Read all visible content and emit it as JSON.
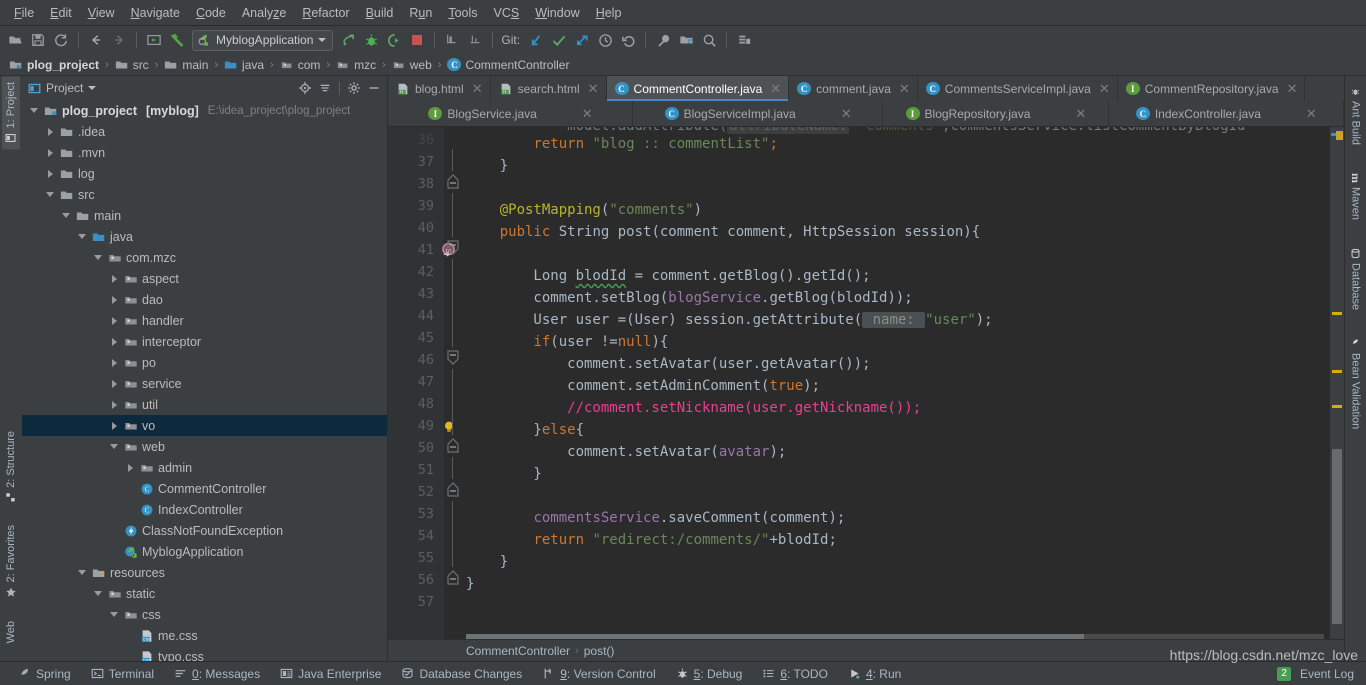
{
  "menubar": {
    "items": [
      {
        "label": "File",
        "mnemonic": "F"
      },
      {
        "label": "Edit",
        "mnemonic": "E"
      },
      {
        "label": "View",
        "mnemonic": "V"
      },
      {
        "label": "Navigate",
        "mnemonic": "N"
      },
      {
        "label": "Code",
        "mnemonic": "C"
      },
      {
        "label": "Analyze",
        "mnemonic": "z"
      },
      {
        "label": "Refactor",
        "mnemonic": "R"
      },
      {
        "label": "Build",
        "mnemonic": "B"
      },
      {
        "label": "Run",
        "mnemonic": "u"
      },
      {
        "label": "Tools",
        "mnemonic": "T"
      },
      {
        "label": "VCS",
        "mnemonic": "S"
      },
      {
        "label": "Window",
        "mnemonic": "W"
      },
      {
        "label": "Help",
        "mnemonic": "H"
      }
    ]
  },
  "toolbar": {
    "run_config": "MyblogApplication",
    "git_label": "Git:",
    "icons": [
      "open-folder-icon",
      "save-icon",
      "sync-icon",
      "back-arrow-icon",
      "forward-arrow-icon",
      "run-anything-icon",
      "build-hammer-icon"
    ],
    "right_icons": [
      "run-icon",
      "debug-icon",
      "run-coverage-icon",
      "stop-icon",
      "profile-icon",
      "attach-icon",
      "update-project-icon",
      "commit-icon",
      "push-icon",
      "history-icon",
      "rollback-icon",
      "settings-wrench-icon",
      "project-structure-icon",
      "search-everywhere-icon",
      "stack-icon"
    ]
  },
  "breadcrumb": {
    "items": [
      {
        "label": "plog_project",
        "icon": "module-icon",
        "bold": true
      },
      {
        "label": "src",
        "icon": "folder-icon",
        "bold": false
      },
      {
        "label": "main",
        "icon": "folder-icon",
        "bold": false
      },
      {
        "label": "java",
        "icon": "source-folder-icon",
        "bold": false
      },
      {
        "label": "com",
        "icon": "package-icon",
        "bold": false
      },
      {
        "label": "mzc",
        "icon": "package-icon",
        "bold": false
      },
      {
        "label": "web",
        "icon": "package-icon",
        "bold": false
      },
      {
        "label": "CommentController",
        "icon": "java-class-icon",
        "bold": false
      }
    ],
    "separator": "›"
  },
  "left_tool_tabs": [
    {
      "label": "1: Project",
      "icon": "project-icon",
      "active": true
    },
    {
      "label": "2: Structure",
      "icon": "structure-icon",
      "active": false
    },
    {
      "label": "2: Favorites",
      "icon": "star-icon",
      "active": false
    },
    {
      "label": "Web",
      "icon": "web-icon",
      "active": false
    }
  ],
  "right_tool_tabs": [
    {
      "label": "Ant Build",
      "icon": "ant-icon"
    },
    {
      "label": "Maven",
      "icon": "maven-icon"
    },
    {
      "label": "Database",
      "icon": "database-icon"
    },
    {
      "label": "Bean Validation",
      "icon": "bean-icon"
    }
  ],
  "project_panel": {
    "title": "Project",
    "actions": [
      "locate-icon",
      "collapse-all-icon",
      "settings-gear-icon",
      "hide-icon"
    ],
    "tree": [
      {
        "indent": 0,
        "twisty": "down",
        "icon": "module-icon",
        "label": "plog_project",
        "bold": true,
        "suffix": "[myblog]",
        "path": "E:\\idea_project\\plog_project",
        "selected": false
      },
      {
        "indent": 1,
        "twisty": "right",
        "icon": "folder-icon",
        "label": ".idea",
        "selected": false
      },
      {
        "indent": 1,
        "twisty": "right",
        "icon": "folder-icon",
        "label": ".mvn",
        "selected": false
      },
      {
        "indent": 1,
        "twisty": "right",
        "icon": "folder-icon",
        "label": "log",
        "selected": false
      },
      {
        "indent": 1,
        "twisty": "down",
        "icon": "folder-icon",
        "label": "src",
        "selected": false
      },
      {
        "indent": 2,
        "twisty": "down",
        "icon": "folder-icon",
        "label": "main",
        "selected": false
      },
      {
        "indent": 3,
        "twisty": "down",
        "icon": "source-folder-icon",
        "label": "java",
        "selected": false
      },
      {
        "indent": 4,
        "twisty": "down",
        "icon": "package-icon",
        "label": "com.mzc",
        "selected": false
      },
      {
        "indent": 5,
        "twisty": "right",
        "icon": "package-icon",
        "label": "aspect",
        "selected": false
      },
      {
        "indent": 5,
        "twisty": "right",
        "icon": "package-icon",
        "label": "dao",
        "selected": false
      },
      {
        "indent": 5,
        "twisty": "right",
        "icon": "package-icon",
        "label": "handler",
        "selected": false
      },
      {
        "indent": 5,
        "twisty": "right",
        "icon": "package-icon",
        "label": "interceptor",
        "selected": false
      },
      {
        "indent": 5,
        "twisty": "right",
        "icon": "package-icon",
        "label": "po",
        "selected": false
      },
      {
        "indent": 5,
        "twisty": "right",
        "icon": "package-icon",
        "label": "service",
        "selected": false
      },
      {
        "indent": 5,
        "twisty": "right",
        "icon": "package-icon",
        "label": "util",
        "selected": false
      },
      {
        "indent": 5,
        "twisty": "right",
        "icon": "package-icon",
        "label": "vo",
        "selected": true
      },
      {
        "indent": 5,
        "twisty": "down",
        "icon": "package-icon",
        "label": "web",
        "selected": false
      },
      {
        "indent": 6,
        "twisty": "right",
        "icon": "package-icon",
        "label": "admin",
        "selected": false
      },
      {
        "indent": 6,
        "twisty": "none",
        "icon": "java-class-icon",
        "label": "CommentController",
        "selected": false
      },
      {
        "indent": 6,
        "twisty": "none",
        "icon": "java-class-icon",
        "label": "IndexController",
        "selected": false
      },
      {
        "indent": 5,
        "twisty": "none",
        "icon": "java-exception-icon",
        "label": "ClassNotFoundException",
        "selected": false
      },
      {
        "indent": 5,
        "twisty": "none",
        "icon": "spring-boot-app-icon",
        "label": "MyblogApplication",
        "selected": false
      },
      {
        "indent": 3,
        "twisty": "down",
        "icon": "resources-folder-icon",
        "label": "resources",
        "selected": false
      },
      {
        "indent": 4,
        "twisty": "down",
        "icon": "package-icon",
        "label": "static",
        "selected": false
      },
      {
        "indent": 5,
        "twisty": "down",
        "icon": "package-icon",
        "label": "css",
        "selected": false
      },
      {
        "indent": 6,
        "twisty": "none",
        "icon": "css-file-icon",
        "label": "me.css",
        "selected": false
      },
      {
        "indent": 6,
        "twisty": "none",
        "icon": "css-file-icon",
        "label": "typo.css",
        "selected": false
      }
    ]
  },
  "editor": {
    "tabs_row1": [
      {
        "label": "blog.html",
        "icon": "html-file-icon",
        "active": false,
        "closable": true
      },
      {
        "label": "search.html",
        "icon": "html-file-icon",
        "active": false,
        "closable": true
      },
      {
        "label": "CommentController.java",
        "icon": "java-class-icon",
        "active": true,
        "closable": true
      },
      {
        "label": "comment.java",
        "icon": "java-class-icon",
        "active": false,
        "closable": true
      },
      {
        "label": "CommentsServiceImpl.java",
        "icon": "java-class-icon",
        "active": false,
        "closable": true
      },
      {
        "label": "CommentRepository.java",
        "icon": "java-interface-icon",
        "active": false,
        "closable": true
      }
    ],
    "tabs_row2": [
      {
        "label": "BlogService.java",
        "icon": "java-interface-icon",
        "active": false,
        "closable": true
      },
      {
        "label": "BlogServiceImpl.java",
        "icon": "java-class-icon",
        "active": false,
        "closable": true
      },
      {
        "label": "BlogRepository.java",
        "icon": "java-interface-icon",
        "active": false,
        "closable": true
      },
      {
        "label": "IndexController.java",
        "icon": "java-class-icon",
        "active": false,
        "closable": true
      }
    ],
    "first_line_number": 36,
    "lines": [
      {
        "n": 36,
        "clipped": true,
        "fold": "none",
        "tokens": [
          {
            "t": "            model.addAttribute(",
            "c": "punct"
          },
          {
            "t": "attributeName:",
            "c": "hint"
          },
          {
            "t": " ",
            "c": "punct"
          },
          {
            "t": "\"comments\"",
            "c": "str"
          },
          {
            "t": ",commentsService.listCommentByBlogId",
            "c": "punct"
          }
        ]
      },
      {
        "n": 37,
        "fold": "none",
        "tokens": [
          {
            "t": "        ",
            "c": "punct"
          },
          {
            "t": "return",
            "c": "kw"
          },
          {
            "t": " ",
            "c": "punct"
          },
          {
            "t": "\"blog :: commentList\"",
            "c": "str"
          },
          {
            "t": ";",
            "c": "semi"
          }
        ]
      },
      {
        "n": 38,
        "fold": "end",
        "tokens": [
          {
            "t": "    }",
            "c": "punct"
          }
        ]
      },
      {
        "n": 39,
        "fold": "none",
        "tokens": [
          {
            "t": "",
            "c": "punct"
          }
        ]
      },
      {
        "n": 40,
        "fold": "none",
        "tokens": [
          {
            "t": "    ",
            "c": "punct"
          },
          {
            "t": "@PostMapping",
            "c": "ann"
          },
          {
            "t": "(",
            "c": "punct"
          },
          {
            "t": "\"comments\"",
            "c": "str"
          },
          {
            "t": ")",
            "c": "punct"
          }
        ]
      },
      {
        "n": 41,
        "fold": "start",
        "marker": "override-icon",
        "tokens": [
          {
            "t": "    ",
            "c": "punct"
          },
          {
            "t": "public",
            "c": "kw"
          },
          {
            "t": " String post(comment comment, HttpSession session){",
            "c": "punct"
          }
        ]
      },
      {
        "n": 42,
        "fold": "none",
        "tokens": [
          {
            "t": "",
            "c": "punct"
          }
        ]
      },
      {
        "n": 43,
        "fold": "none",
        "tokens": [
          {
            "t": "        Long ",
            "c": "punct"
          },
          {
            "t": "blodId",
            "c": "squiggle"
          },
          {
            "t": " = comment.getBlog().getId();",
            "c": "punct"
          }
        ]
      },
      {
        "n": 44,
        "fold": "none",
        "tokens": [
          {
            "t": "        comment.setBlog(",
            "c": "punct"
          },
          {
            "t": "blogService",
            "c": "fld"
          },
          {
            "t": ".getBlog(blodId));",
            "c": "punct"
          }
        ]
      },
      {
        "n": 45,
        "fold": "none",
        "tokens": [
          {
            "t": "        User user =(User) session.getAttribute(",
            "c": "punct"
          },
          {
            "t": " name: ",
            "c": "hint"
          },
          {
            "t": "\"user\"",
            "c": "str"
          },
          {
            "t": ");",
            "c": "punct"
          }
        ]
      },
      {
        "n": 46,
        "fold": "start",
        "tokens": [
          {
            "t": "        ",
            "c": "punct"
          },
          {
            "t": "if",
            "c": "kw"
          },
          {
            "t": "(user !=",
            "c": "punct"
          },
          {
            "t": "null",
            "c": "kw"
          },
          {
            "t": "){",
            "c": "punct"
          }
        ]
      },
      {
        "n": 47,
        "fold": "none",
        "tokens": [
          {
            "t": "            comment.setAvatar(user.getAvatar());",
            "c": "punct"
          }
        ]
      },
      {
        "n": 48,
        "fold": "none",
        "tokens": [
          {
            "t": "            comment.setAdminComment(",
            "c": "punct"
          },
          {
            "t": "true",
            "c": "kw"
          },
          {
            "t": ");",
            "c": "punct"
          }
        ]
      },
      {
        "n": 49,
        "fold": "none",
        "marker": "intention-bulb-icon",
        "tokens": [
          {
            "t": "            //comment.setNickname(user.getNickname());",
            "c": "cmt"
          }
        ]
      },
      {
        "n": 50,
        "fold": "end",
        "tokens": [
          {
            "t": "        }",
            "c": "punct"
          },
          {
            "t": "else",
            "c": "kw"
          },
          {
            "t": "{",
            "c": "punct"
          }
        ]
      },
      {
        "n": 51,
        "fold": "none",
        "tokens": [
          {
            "t": "            comment.setAvatar(",
            "c": "punct"
          },
          {
            "t": "avatar",
            "c": "fld"
          },
          {
            "t": ");",
            "c": "punct"
          }
        ]
      },
      {
        "n": 52,
        "fold": "end",
        "tokens": [
          {
            "t": "        }",
            "c": "punct"
          }
        ]
      },
      {
        "n": 53,
        "fold": "none",
        "tokens": [
          {
            "t": "",
            "c": "punct"
          }
        ]
      },
      {
        "n": 54,
        "fold": "none",
        "tokens": [
          {
            "t": "        ",
            "c": "punct"
          },
          {
            "t": "commentsService",
            "c": "fld"
          },
          {
            "t": ".saveComment(comment);",
            "c": "punct"
          }
        ]
      },
      {
        "n": 55,
        "fold": "none",
        "tokens": [
          {
            "t": "        ",
            "c": "punct"
          },
          {
            "t": "return",
            "c": "kw"
          },
          {
            "t": " ",
            "c": "punct"
          },
          {
            "t": "\"redirect:/comments/\"",
            "c": "str"
          },
          {
            "t": "+blodId;",
            "c": "punct"
          }
        ]
      },
      {
        "n": 56,
        "fold": "end",
        "tokens": [
          {
            "t": "    }",
            "c": "punct"
          }
        ]
      },
      {
        "n": 57,
        "fold": "none",
        "tokens": [
          {
            "t": "}",
            "c": "punct"
          }
        ]
      }
    ],
    "bottom_breadcrumb": [
      "CommentController",
      "post()"
    ],
    "bottom_breadcrumb_sep": "›"
  },
  "statusbar": {
    "items": [
      {
        "label": "Spring",
        "icon": "spring-icon",
        "mnemonic": ""
      },
      {
        "label": "Terminal",
        "icon": "terminal-icon",
        "mnemonic": ""
      },
      {
        "label": "0: Messages",
        "icon": "messages-icon",
        "mnemonic": "0"
      },
      {
        "label": "Java Enterprise",
        "icon": "java-enterprise-icon",
        "mnemonic": ""
      },
      {
        "label": "Database Changes",
        "icon": "database-changes-icon",
        "mnemonic": ""
      },
      {
        "label": "9: Version Control",
        "icon": "version-control-icon",
        "mnemonic": "9"
      },
      {
        "label": "5: Debug",
        "icon": "debug-icon",
        "mnemonic": "5"
      },
      {
        "label": "6: TODO",
        "icon": "todo-icon",
        "mnemonic": "6"
      },
      {
        "label": "4: Run",
        "icon": "run-icon",
        "mnemonic": "4"
      }
    ],
    "event_log": {
      "label": "Event Log",
      "badge": "2"
    }
  },
  "watermark": "https://blog.csdn.net/mzc_love",
  "colors": {
    "panel_bg": "#3c3f41",
    "editor_bg": "#2b2b2b",
    "gutter_bg": "#313335",
    "selection_blue": "#0d293e",
    "accent_blue": "#4a88c7",
    "text": "#bbbbbb",
    "code_text": "#a9b7c6",
    "keyword": "#cc7832",
    "string": "#6a8759",
    "annotation": "#bbb529",
    "field": "#9876aa",
    "comment_pink": "#e8408f",
    "marker_yellow": "#d6ac00",
    "green": "#499c54"
  }
}
